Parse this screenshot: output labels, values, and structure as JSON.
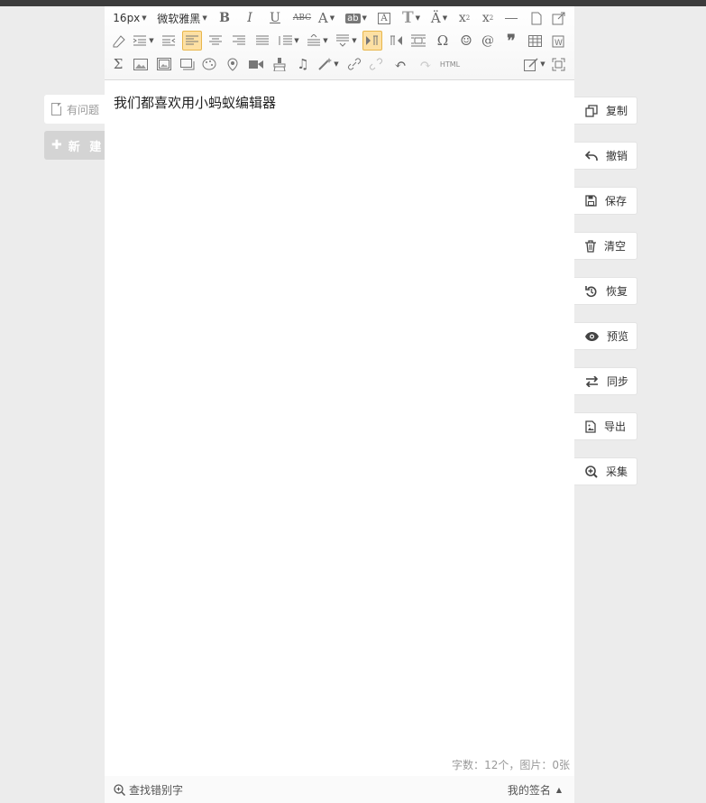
{
  "left": {
    "tab_label": "有问题",
    "new_label": "新 建"
  },
  "toolbar": {
    "font_size": "16px",
    "font_family": "微软雅黑",
    "html_label": "HTML"
  },
  "editor": {
    "content": "我们都喜欢用小蚂蚁编辑器",
    "word_count_label": "字数：",
    "word_count": "12个",
    "sep": "，图片：",
    "image_count": "0张"
  },
  "footer": {
    "find_typo": "查找错别字",
    "signature": "我的签名"
  },
  "actions": [
    {
      "label": "复制",
      "icon": "copy-icon"
    },
    {
      "label": "撤销",
      "icon": "undo-icon"
    },
    {
      "label": "保存",
      "icon": "save-icon"
    },
    {
      "label": "清空",
      "icon": "trash-icon"
    },
    {
      "label": "恢复",
      "icon": "restore-icon"
    },
    {
      "label": "预览",
      "icon": "eye-icon"
    },
    {
      "label": "同步",
      "icon": "sync-icon"
    },
    {
      "label": "导出",
      "icon": "export-icon"
    },
    {
      "label": "采集",
      "icon": "collect-icon"
    }
  ]
}
